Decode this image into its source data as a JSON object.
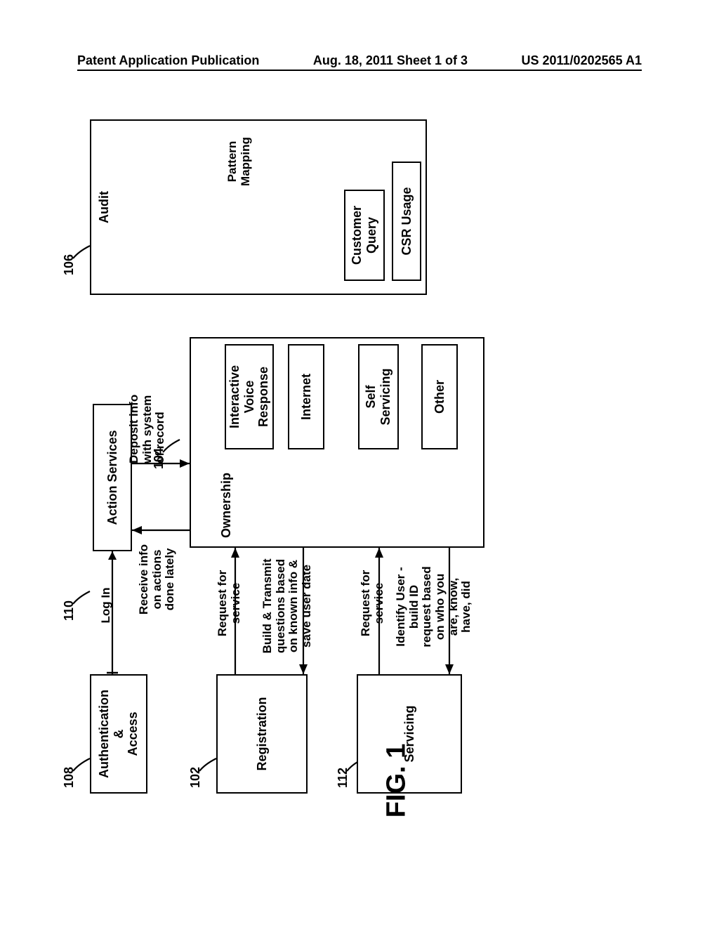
{
  "header": {
    "left": "Patent Application Publication",
    "center": "Aug. 18, 2011  Sheet 1 of 3",
    "right": "US 2011/0202565 A1"
  },
  "figure_label": "FIG. 1",
  "refs": {
    "r108": "108",
    "r110": "110",
    "r102": "102",
    "r112": "112",
    "r104": "104",
    "r106": "106"
  },
  "boxes": {
    "auth_access": "Authentication\n&\nAccess",
    "action_services": "Action Services",
    "registration": "Registration",
    "servicing": "Servicing",
    "ownership": "Ownership",
    "ivr": "Interactive\nVoice\nResponse",
    "internet": "Internet",
    "self_servicing": "Self\nServicing",
    "other": "Other",
    "audit": "Audit",
    "customer_query": "Customer\nQuery",
    "csr_usage": "CSR Usage"
  },
  "labels": {
    "log_in": "Log In",
    "receive_info": "Receive info\non actions\ndone lately",
    "deposit_info": "Deposit info\nwith system\nof record",
    "request_service_1": "Request for\nservice",
    "build_transmit": "Build & Transmit\nquestions based\non known info &\nsave user date",
    "request_service_2": "Request for\nservice",
    "identify_user": "Identify User -\nbuild ID\nrequest based\non who you\nare, know,\nhave, did",
    "pattern_mapping": "Pattern\nMapping"
  }
}
